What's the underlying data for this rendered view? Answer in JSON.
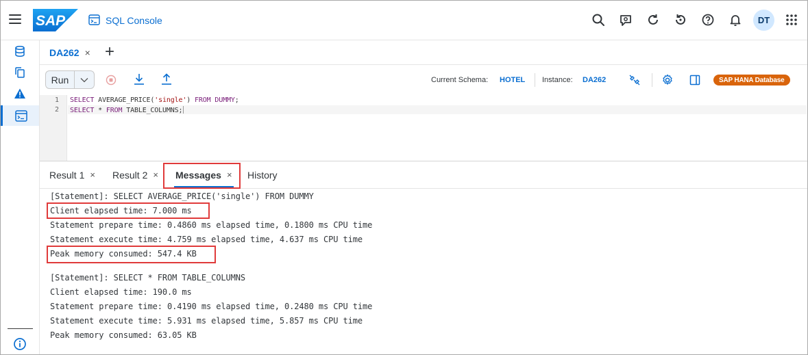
{
  "shell": {
    "logo_text": "SAP",
    "app_title": "SQL Console",
    "avatar_initials": "DT",
    "icons": [
      "menu-icon",
      "search-icon",
      "feedback-icon",
      "refresh-icon",
      "history-icon",
      "help-icon",
      "notifications-icon",
      "apps-grid-icon"
    ]
  },
  "sidebar": {
    "items": [
      "database-explorer-icon",
      "copy-icon",
      "warning-icon",
      "sql-console-icon"
    ],
    "footer_icon": "info-icon"
  },
  "editor_tabs": [
    {
      "label": "DA262",
      "close": "×"
    }
  ],
  "editor_tab_add": "+",
  "toolbar": {
    "run_label": "Run",
    "schema_label": "Current Schema:",
    "schema_value": "HOTEL",
    "instance_label": "Instance:",
    "instance_value": "DA262",
    "badge": "SAP HANA Database"
  },
  "editor": {
    "lines": [
      {
        "number": "1",
        "code": "SELECT AVERAGE_PRICE('single') FROM DUMMY;"
      },
      {
        "number": "2",
        "code": "SELECT * FROM TABLE_COLUMNS;"
      }
    ]
  },
  "result_tabs": [
    {
      "label": "Result 1",
      "close": "×"
    },
    {
      "label": "Result 2",
      "close": "×"
    },
    {
      "label": "Messages",
      "close": "×"
    },
    {
      "label": "History",
      "close": ""
    }
  ],
  "messages": [
    "[Statement]: SELECT AVERAGE_PRICE('single') FROM DUMMY",
    "Client elapsed time: 7.000 ms",
    "Statement prepare time: 0.4860 ms elapsed time, 0.1800 ms CPU time",
    "Statement execute time: 4.759 ms elapsed time, 4.637 ms CPU time",
    "Peak memory consumed: 547.4 KB",
    "[Statement]: SELECT * FROM TABLE_COLUMNS",
    "Client elapsed time: 190.0 ms",
    "Statement prepare time: 0.4190 ms elapsed time, 0.2480 ms CPU time",
    "Statement execute time: 5.931 ms elapsed time, 5.857 ms CPU time",
    "Peak memory consumed: 63.05 KB"
  ],
  "colors": {
    "accent": "#0a6ed1",
    "badge": "#d9640b",
    "highlight": "#e03a3a"
  }
}
